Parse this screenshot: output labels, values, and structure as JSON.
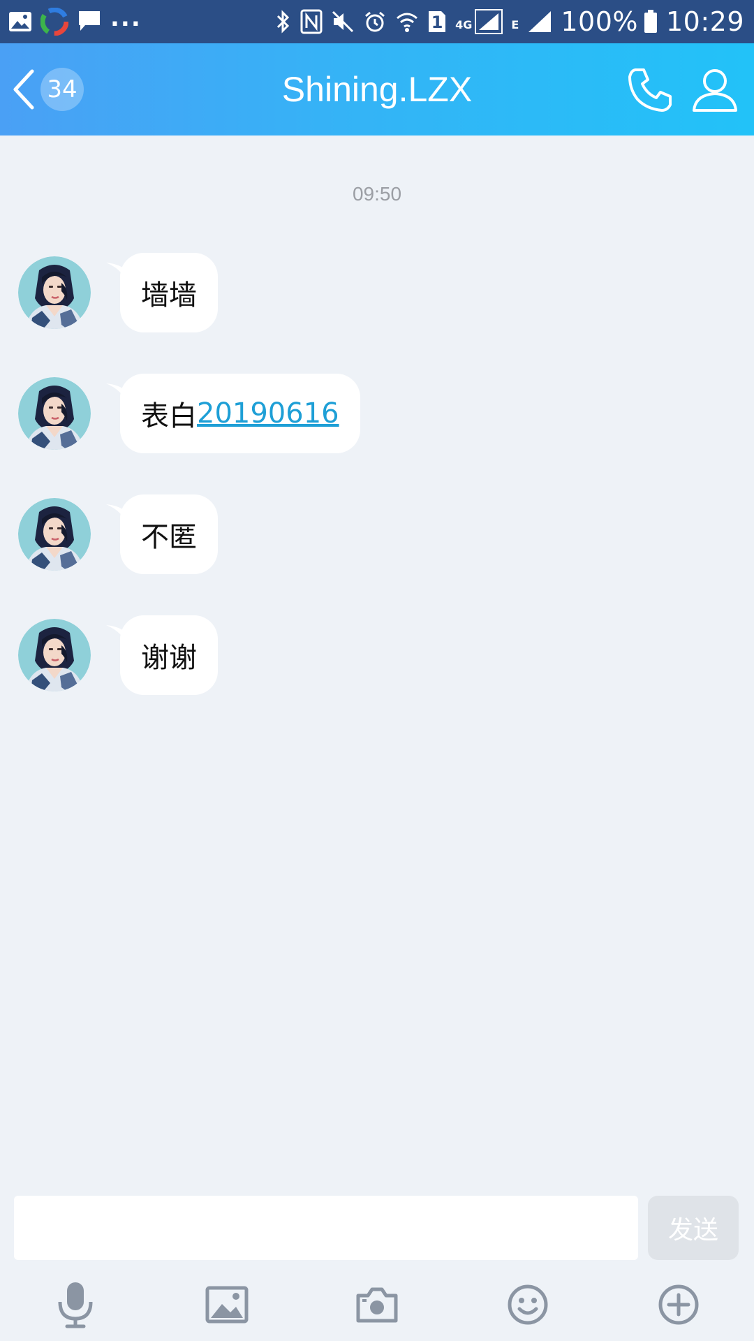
{
  "status_bar": {
    "battery": "100%",
    "time": "10:29",
    "network": "4G",
    "network2": "E",
    "sim_slot": "1",
    "overflow": "..."
  },
  "header": {
    "unread_count": "34",
    "title": "Shining.LZX"
  },
  "chat": {
    "timestamp": "09:50",
    "messages": [
      {
        "text": "墙墙",
        "link": ""
      },
      {
        "text": "表白",
        "link": "20190616"
      },
      {
        "text": "不匿",
        "link": ""
      },
      {
        "text": "谢谢",
        "link": ""
      }
    ]
  },
  "input": {
    "placeholder": "",
    "value": "",
    "send_label": "发送"
  },
  "colors": {
    "header_gradient_start": "#4aa0f5",
    "header_gradient_end": "#22c2f8",
    "chat_background": "#eef2f7",
    "link": "#1e9fd6",
    "send_disabled": "#dfe3e8"
  },
  "toolbar_icons": [
    "microphone-icon",
    "image-icon",
    "camera-icon",
    "emoji-icon",
    "plus-icon"
  ]
}
